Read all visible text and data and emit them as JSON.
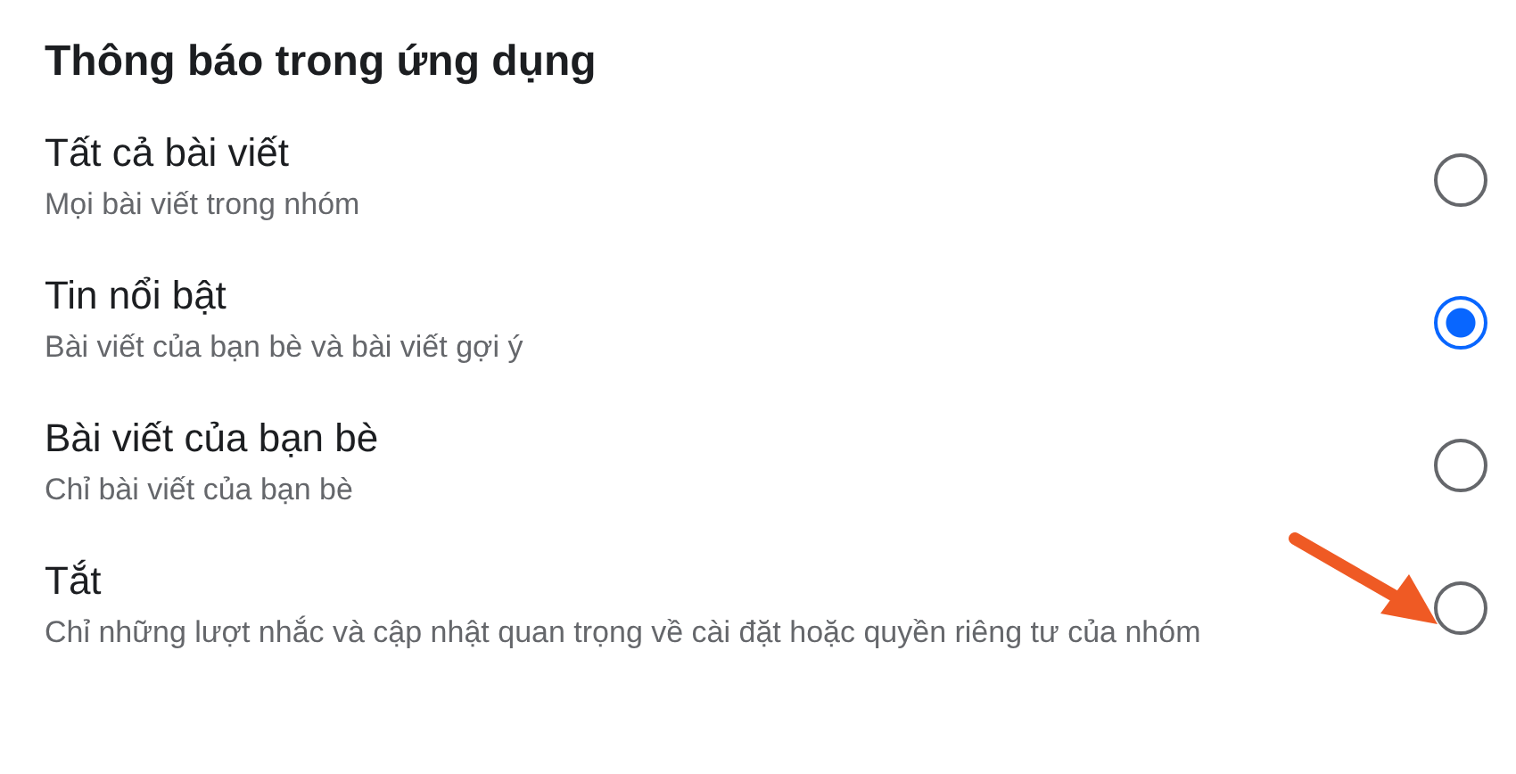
{
  "title": "Thông báo trong ứng dụng",
  "options": [
    {
      "title": "Tất cả bài viết",
      "subtitle": "Mọi bài viết trong nhóm",
      "selected": false
    },
    {
      "title": "Tin nổi bật",
      "subtitle": "Bài viết của bạn bè và bài viết gợi ý",
      "selected": true
    },
    {
      "title": "Bài viết của bạn bè",
      "subtitle": "Chỉ bài viết của bạn bè",
      "selected": false
    },
    {
      "title": "Tắt",
      "subtitle": "Chỉ những lượt nhắc và cập nhật quan trọng về cài đặt hoặc quyền riêng tư của nhóm",
      "selected": false
    }
  ]
}
